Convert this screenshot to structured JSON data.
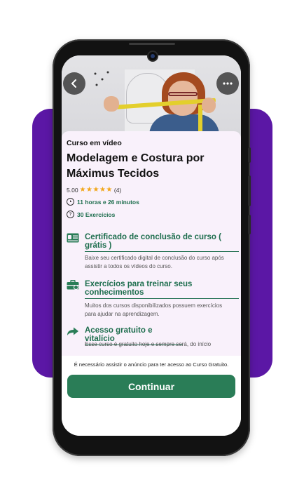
{
  "video": {
    "back_icon": "chevron-left-icon",
    "menu_icon": "more-horizontal-icon"
  },
  "course": {
    "kicker": "Curso em vídeo",
    "title": "Modelagem e Costura por Máximus Tecidos",
    "rating_value": "5.00",
    "stars": "★★★★★",
    "rating_count": "(4)",
    "duration": "11 horas e 26 minutos",
    "exercises": "30 Exercícios"
  },
  "features": [
    {
      "icon": "certificate-icon",
      "title": "Certificado de conclusão de curso ( grátis )",
      "description": "Baixe seu certificado digital de conclusão do curso após assistir a todos os vídeos do curso."
    },
    {
      "icon": "toolbox-icon",
      "title": "Exercícios para treinar seus conhecimentos",
      "description": "Muitos dos cursos disponibilizados possuem exercícios para ajudar na aprendizagem."
    },
    {
      "icon": "share-arrow-icon",
      "title": "Acesso gratuito e vitalício",
      "description": "Esse curso é gratuito hoje e sempre será, do início"
    }
  ],
  "footer": {
    "notice": "É necessário assistir o anúncio para ter acesso ao Curso Gratuito.",
    "continue_label": "Continuar"
  },
  "colors": {
    "accent": "#2a7d57",
    "background_block": "#5b17a5",
    "card": "#f9f1fb",
    "star": "#f1a619"
  }
}
